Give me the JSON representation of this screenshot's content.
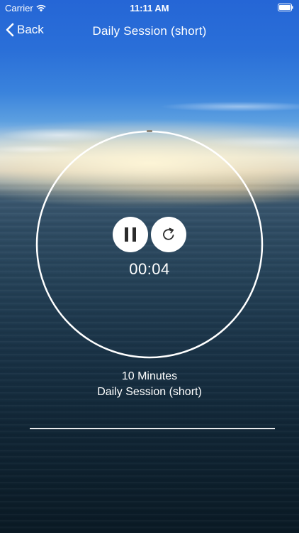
{
  "status_bar": {
    "carrier": "Carrier",
    "time": "11:11 AM"
  },
  "nav": {
    "back_label": "Back",
    "title": "Daily Session (short)"
  },
  "player": {
    "elapsed": "00:04",
    "pause_icon": "pause-icon",
    "restart_icon": "restart-icon",
    "progress_fraction": 0.007
  },
  "session": {
    "duration": "10 Minutes",
    "name": "Daily Session (short)"
  },
  "colors": {
    "ring": "#ffffff",
    "progress_marker": "#8a8478",
    "button_bg": "#ffffff",
    "icon": "#2b2b2b"
  }
}
